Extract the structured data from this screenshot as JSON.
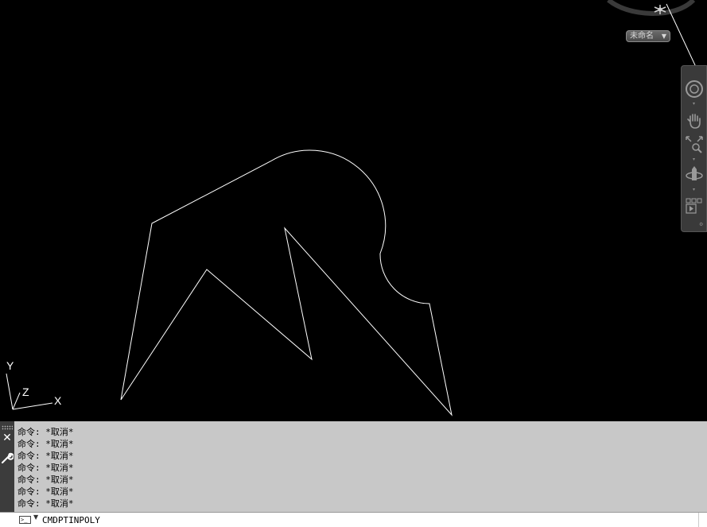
{
  "view_cube": {
    "ucs_name": "未命名",
    "colors": {
      "ring": "#3a3a3a",
      "compass_marker": "#d0d0d0"
    }
  },
  "navigation_bar": {
    "tools": [
      {
        "icon": "steering-wheel-icon"
      },
      {
        "icon": "pan-hand-icon"
      },
      {
        "icon": "zoom-extents-icon"
      },
      {
        "icon": "orbit-icon"
      },
      {
        "icon": "showmotion-icon"
      }
    ]
  },
  "ucs_icon": {
    "y_label": "Y",
    "z_label": "Z",
    "x_label": "X"
  },
  "command_line": {
    "history": [
      "命令: *取消*",
      "命令: *取消*",
      "命令: *取消*",
      "命令: *取消*",
      "命令: *取消*",
      "命令: *取消*",
      "命令: *取消*"
    ],
    "input_value": "CMDPTINPOLY"
  },
  "colors": {
    "canvas_background": "#000000",
    "drawing_stroke": "#ffffff",
    "command_history_background": "#c8c8c8",
    "command_input_background": "#ffffff"
  }
}
